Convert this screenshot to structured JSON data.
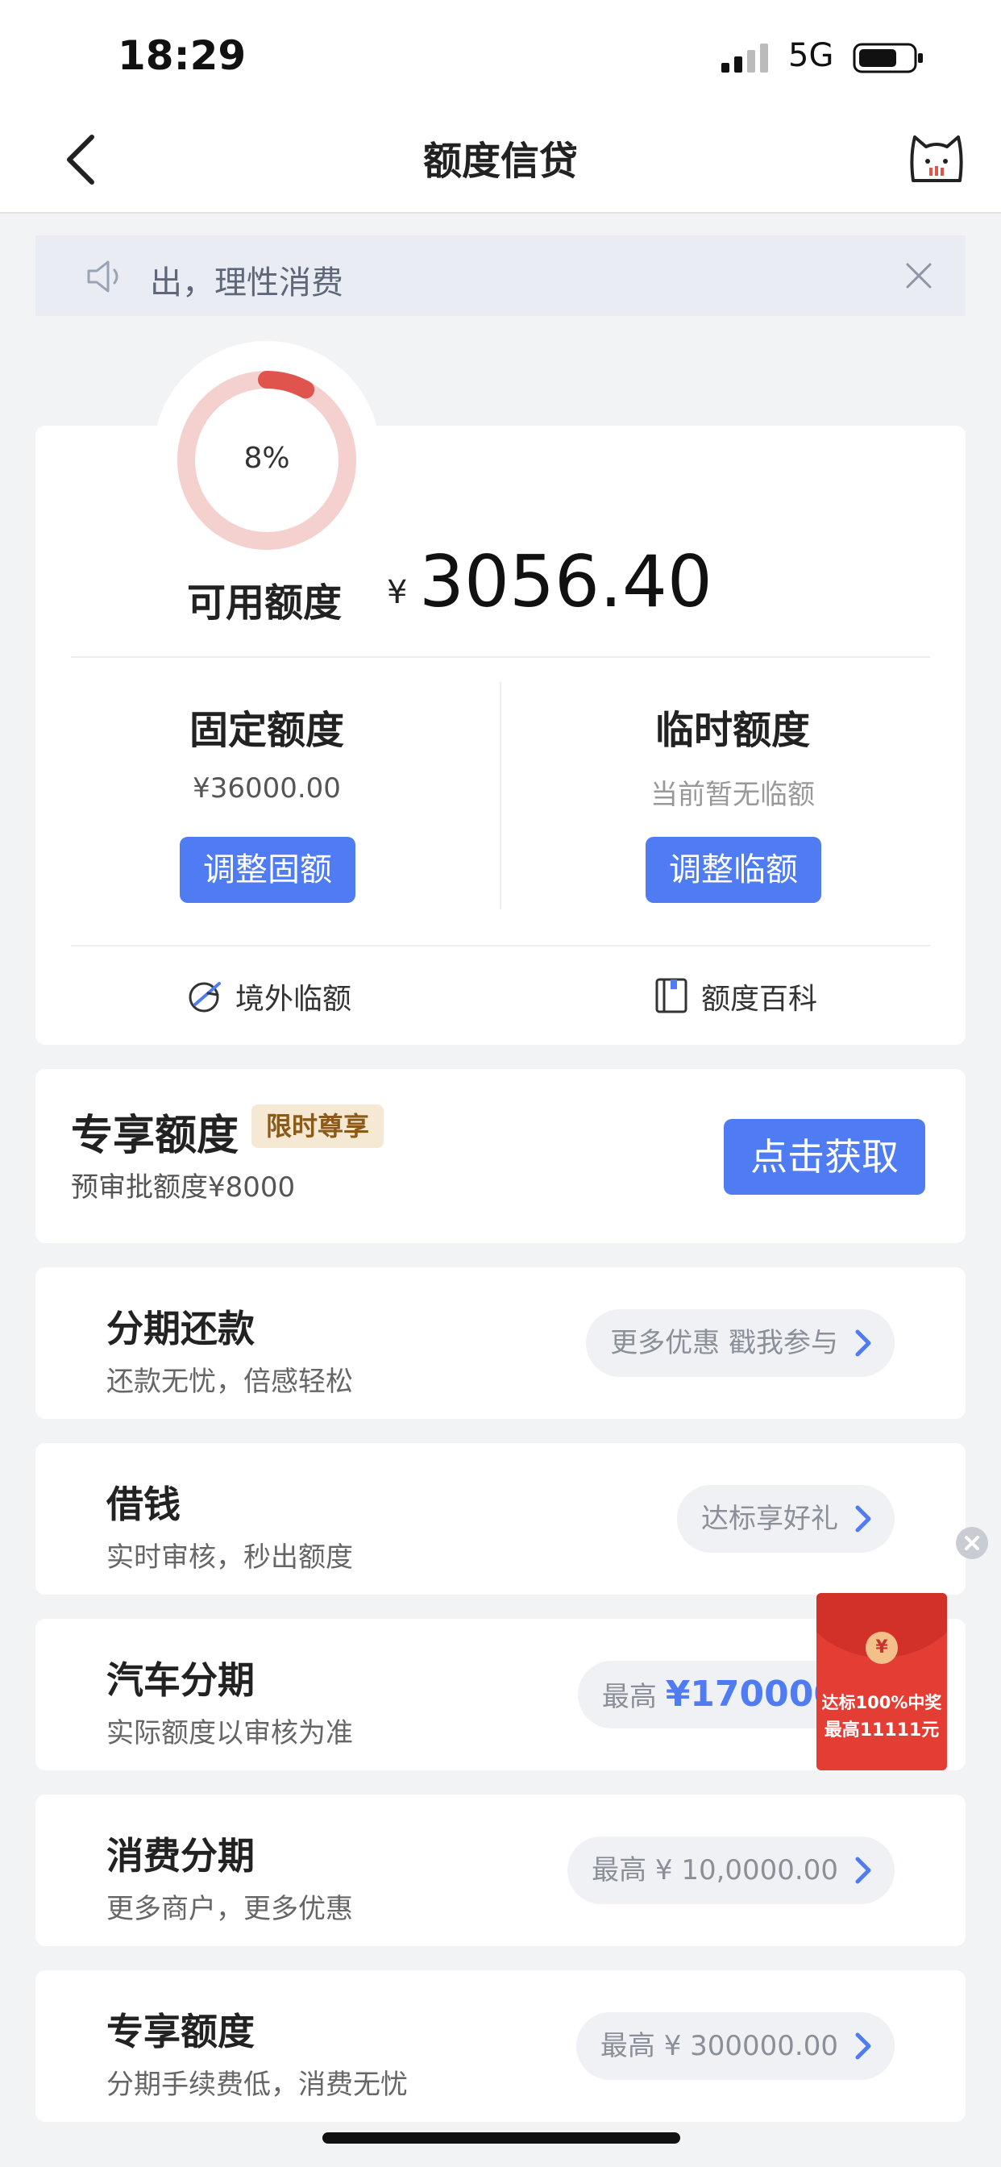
{
  "status_bar": {
    "time": "18:29",
    "network": "5G"
  },
  "header": {
    "title": "额度信贷"
  },
  "notice": {
    "text": "出，理性消费"
  },
  "credit": {
    "usage_percent": 8,
    "usage_label": "8%",
    "available_label": "可用额度",
    "currency": "¥",
    "available_amount": "3056.40",
    "fixed": {
      "title": "固定额度",
      "amount": "¥36000.00",
      "button": "调整固额"
    },
    "temporary": {
      "title": "临时额度",
      "status": "当前暂无临额",
      "button": "调整临额"
    },
    "links": {
      "overseas": "境外临额",
      "wiki": "额度百科"
    }
  },
  "exclusive": {
    "title": "专享额度",
    "tag": "限时尊享",
    "subtitle": "预审批额度¥8000",
    "button": "点击获取"
  },
  "services": [
    {
      "title": "分期还款",
      "subtitle": "还款无忧，倍感轻松",
      "pill_prefix": "",
      "pill_amount": "",
      "pill_text": "更多优惠 戳我参与"
    },
    {
      "title": "借钱",
      "subtitle": "实时审核，秒出额度",
      "pill_prefix": "",
      "pill_amount": "",
      "pill_text": "达标享好礼"
    },
    {
      "title": "汽车分期",
      "subtitle": "实际额度以审核为准",
      "pill_prefix": "最高 ",
      "pill_amount": "¥170000",
      "pill_text": ""
    },
    {
      "title": "消费分期",
      "subtitle": "更多商户，更多优惠",
      "pill_prefix": "",
      "pill_amount": "",
      "pill_text": "最高 ¥ 10,0000.00"
    },
    {
      "title": "专享额度",
      "subtitle": "分期手续费低，消费无忧",
      "pill_prefix": "",
      "pill_amount": "",
      "pill_text": "最高 ¥ 300000.00"
    }
  ],
  "red_packet": {
    "coin": "¥",
    "line1": "达标100%中奖",
    "line2": "最高11111元"
  },
  "colors": {
    "accent": "#4f7cf3",
    "ring": "#e0544e",
    "ring_track": "#f4d0cf",
    "red_packet": "#e33d34"
  }
}
